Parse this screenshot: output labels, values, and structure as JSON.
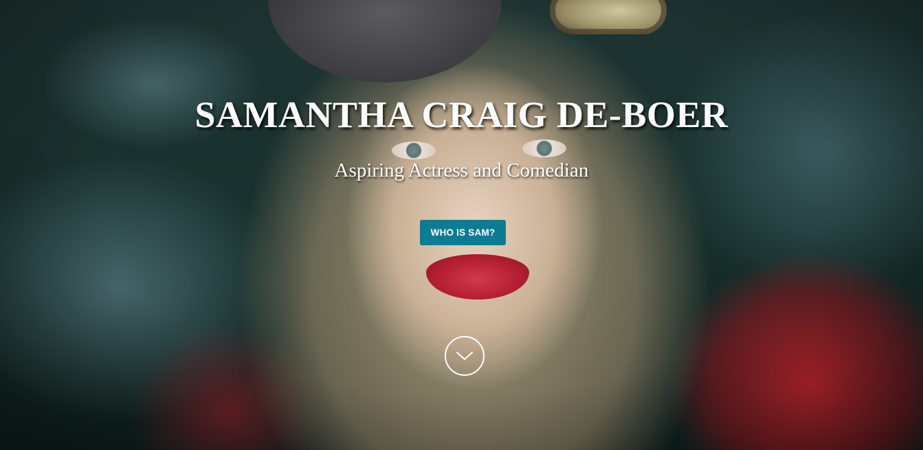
{
  "hero": {
    "title": "SAMANTHA CRAIG DE-BOER",
    "subtitle": "Aspiring Actress and Comedian",
    "cta_label": "WHO IS SAM?",
    "scroll_icon": "chevron-down-icon"
  },
  "colors": {
    "cta_background": "#0d7c93",
    "text": "#ffffff"
  }
}
